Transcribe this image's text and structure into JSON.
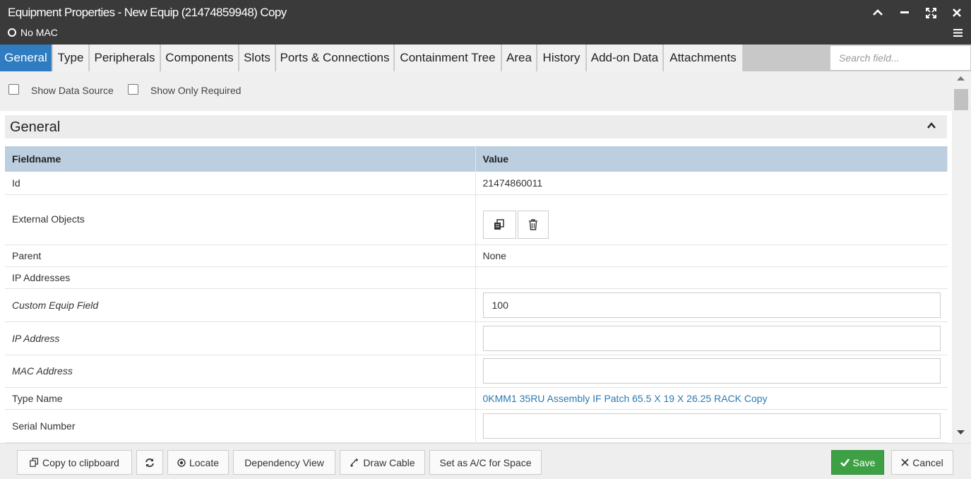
{
  "window": {
    "title": "Equipment Properties - New Equip (21474859948) Copy",
    "status": "No MAC"
  },
  "tabs": [
    {
      "label": "General",
      "active": true
    },
    {
      "label": "Type"
    },
    {
      "label": "Peripherals"
    },
    {
      "label": "Components"
    },
    {
      "label": "Slots"
    },
    {
      "label": "Ports & Connections"
    },
    {
      "label": "Containment Tree"
    },
    {
      "label": "Area"
    },
    {
      "label": "History"
    },
    {
      "label": "Add-on Data"
    },
    {
      "label": "Attachments"
    }
  ],
  "search": {
    "placeholder": "Search field..."
  },
  "options": {
    "show_data_source": "Show Data Source",
    "show_only_required": "Show Only Required"
  },
  "section": {
    "title": "General"
  },
  "table": {
    "headers": {
      "field": "Fieldname",
      "value": "Value"
    },
    "rows": [
      {
        "name": "Id",
        "value": "21474860011"
      },
      {
        "name": "External Objects",
        "value": ""
      },
      {
        "name": "Parent",
        "value": "None"
      },
      {
        "name": "IP Addresses",
        "value": ""
      },
      {
        "name": "Custom Equip Field",
        "value": "100"
      },
      {
        "name": "IP Address",
        "value": ""
      },
      {
        "name": "MAC Address",
        "value": ""
      },
      {
        "name": "Type Name",
        "value": "0KMM1 35RU Assembly IF Patch 65.5 X 19 X 26.25 RACK Copy"
      },
      {
        "name": "Serial Number",
        "value": ""
      }
    ]
  },
  "footer": {
    "copy": "Copy to clipboard",
    "locate": "Locate",
    "dependency": "Dependency View",
    "draw_cable": "Draw Cable",
    "set_ac": "Set as A/C for Space",
    "save": "Save",
    "cancel": "Cancel"
  },
  "colors": {
    "titlebar": "#3a3a3a",
    "active_tab": "#2f7cc0",
    "table_header": "#bccfe0",
    "save": "#3ea045",
    "link": "#2a7ab0"
  }
}
